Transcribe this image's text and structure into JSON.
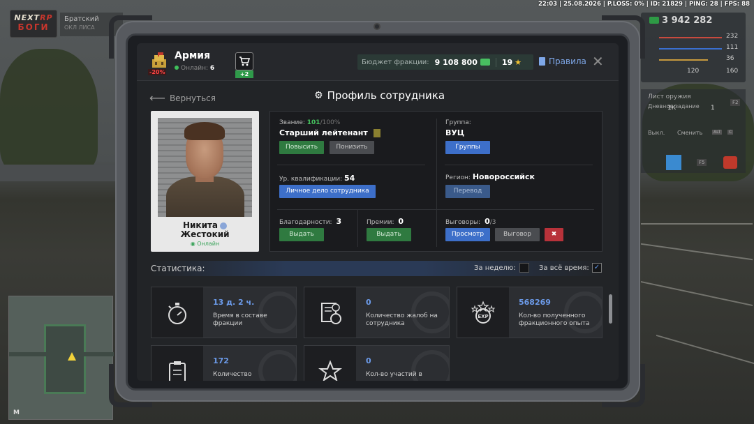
{
  "hud": {
    "status_line": "22:03 | 25.08.2026 | P.LOSS: 0% | ID: 21829 | PING: 28 | FPS: 88",
    "money": "3 942 282",
    "stats": [
      "232",
      "111",
      "36",
      "160"
    ],
    "stat_120": "120",
    "logo_top": "NEXT",
    "logo_rp": "RP",
    "logo_bottom": "БОГИ",
    "location_name": "Братский",
    "location_sub": "ОКЛ ЛИСА",
    "mid_text1": "Лист оружия",
    "mid_text2": "Дневное задание",
    "mid_num1": "1К",
    "mid_num2": "1",
    "mid_key": "F2",
    "mid_row2_left": "Выкл.",
    "mid_row2_right": "Сменить",
    "mid_key2": "ALT",
    "mid_key3": "C",
    "mid_key4": "F5",
    "minimap_letter": "M"
  },
  "faction": {
    "name": "Армия",
    "online_label": "Онлайн:",
    "online_count": "6",
    "penalty": "-20%",
    "cart_badge": "+2",
    "budget_label": "Бюджет фракции:",
    "budget_value": "9 108 800",
    "stars_value": "19",
    "rules_label": "Правила",
    "close_glyph": "✕"
  },
  "page": {
    "back_label": "Вернуться",
    "title": "Профиль сотрудника"
  },
  "employee": {
    "first_name": "Никита",
    "last_name": "Жестокий",
    "status": "Онлайн",
    "rank_label": "Звание:",
    "rank_value": "101",
    "rank_max": "/100%",
    "rank_name": "Старший лейтенант",
    "promote": "Повысить",
    "demote": "Понизить",
    "group_label": "Группа:",
    "group_value": "ВУЦ",
    "groups_btn": "Группы",
    "qual_label": "Ур. квалификации:",
    "qual_value": "54",
    "dossier_btn": "Личное дело сотрудника",
    "region_label": "Регион:",
    "region_value": "Новороссийск",
    "transfer_btn": "Перевод",
    "thanks_label": "Благодарности:",
    "thanks_value": "3",
    "thanks_btn": "Выдать",
    "bonus_label": "Премии:",
    "bonus_value": "0",
    "bonus_btn": "Выдать",
    "reprimand_label": "Выговоры:",
    "reprimand_value": "0",
    "reprimand_max": "/3",
    "view_btn": "Просмотр",
    "reprimand_btn": "Выговор"
  },
  "stats": {
    "label": "Статистика:",
    "week_label": "За неделю:",
    "all_label": "За всё время:",
    "check_glyph": "✓",
    "cards": [
      {
        "value": "13 д. 2 ч.",
        "desc": "Время в составе фракции"
      },
      {
        "value": "0",
        "desc": "Количество жалоб на сотрудника"
      },
      {
        "value": "568269",
        "desc": "Кол-во полученного фракционного опыта"
      },
      {
        "value": "172",
        "desc": "Количество"
      },
      {
        "value": "0",
        "desc": "Кол-во участий в"
      }
    ]
  },
  "colors": {
    "accent_blue": "#6c9bea",
    "green": "#2f7a40",
    "red": "#b8323a"
  }
}
